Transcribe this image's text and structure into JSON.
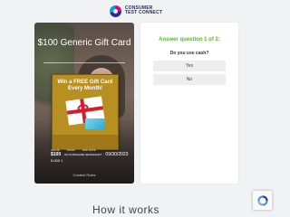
{
  "header": {
    "logo_line1": "CONSUMER",
    "logo_line2": "TEST CONNECT"
  },
  "offer": {
    "title": "$100 Generic Gift Card",
    "promo_text": "Win a FREE Gift Card Every Month!",
    "stat_labels": [
      "VALUE",
      "DRAW",
      "END DATE"
    ],
    "value": "$100",
    "draw": "NO PURCHASE NECESSARY",
    "end_date": "09/30/2023",
    "winners": "5,000 1",
    "contest_rules": "Contest Rules"
  },
  "quiz": {
    "heading": "Answer question 1 of 2:",
    "question": "Do you use cash?",
    "options": [
      "Yes",
      "No"
    ],
    "accent": "#57b533"
  },
  "footer": {
    "heading": "How it works"
  },
  "icons": {
    "recaptcha": "recaptcha-icon"
  }
}
